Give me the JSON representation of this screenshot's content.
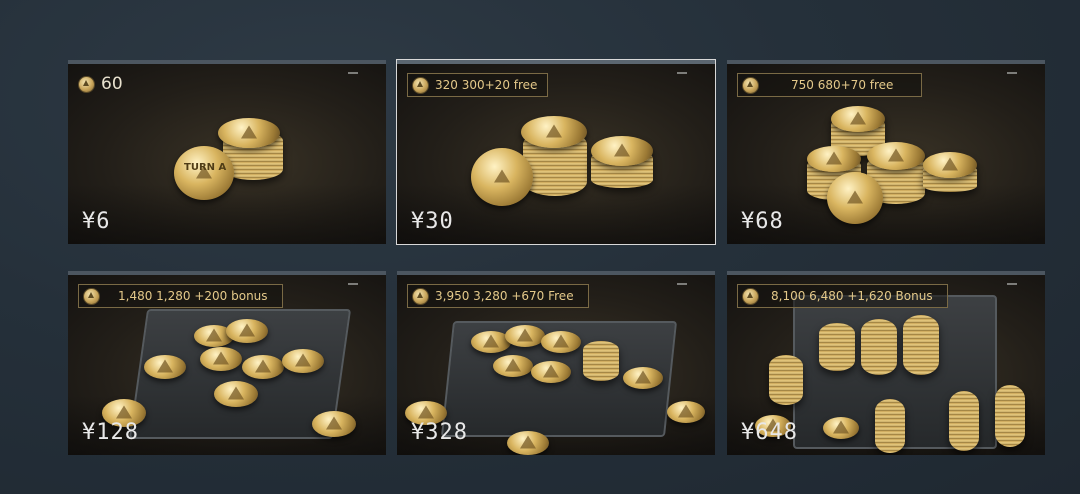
{
  "cards": [
    {
      "amount": "60",
      "price": "¥6",
      "coin_label": "TURN A"
    },
    {
      "amount": "320 300+20 free",
      "price": "¥30"
    },
    {
      "amount": "750 680+70 free",
      "price": "¥68"
    },
    {
      "amount": "1,480 1,280 +200 bonus",
      "price": "¥128"
    },
    {
      "amount": "3,950 3,280 +670 Free",
      "price": "¥328"
    },
    {
      "amount": "8,100 6,480 +1,620 Bonus",
      "price": "¥648"
    }
  ],
  "icons": {
    "currency": "coin-icon"
  },
  "colors": {
    "background": "#26313b",
    "amount_text": "#e4c98a",
    "price_text": "#e8e8e8",
    "selected_outline": "#d8d8d8"
  }
}
